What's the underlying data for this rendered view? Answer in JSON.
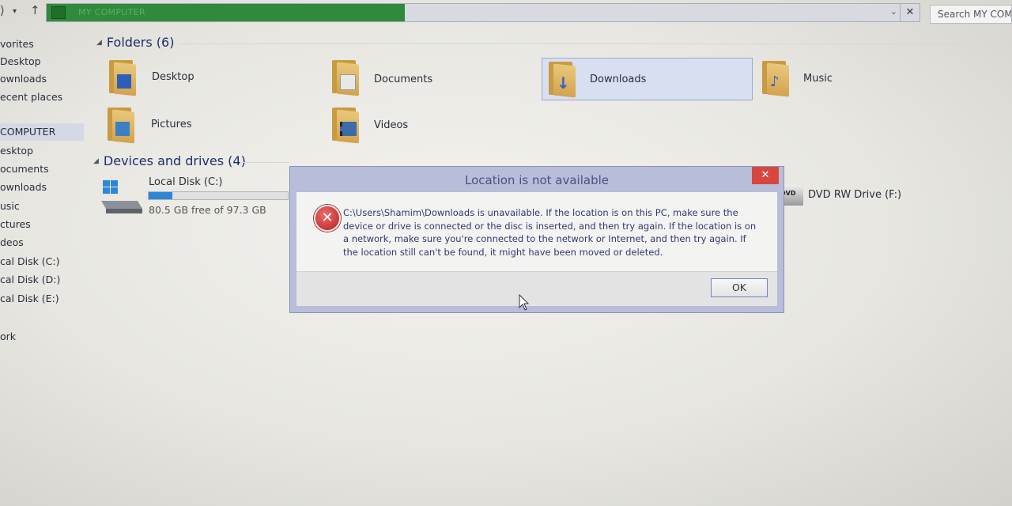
{
  "address_bar": {
    "path": "MY COMPUTER",
    "progress": 0.41
  },
  "search": {
    "placeholder": "Search MY COMP"
  },
  "sidebar": {
    "items": [
      "vorites",
      "Desktop",
      "ownloads",
      "ecent places",
      "COMPUTER",
      "esktop",
      "ocuments",
      "ownloads",
      "usic",
      "ctures",
      "deos",
      "cal Disk (C:)",
      "cal Disk (D:)",
      "cal Disk (E:)",
      "ork"
    ]
  },
  "folders": {
    "title": "Folders (6)",
    "items": [
      "Desktop",
      "Documents",
      "Downloads",
      "Music",
      "Pictures",
      "Videos"
    ]
  },
  "drives": {
    "title": "Devices and drives (4)",
    "local_c": {
      "name": "Local Disk (C:)",
      "free": "80.5 GB free of 97.3 GB",
      "used_fraction": 0.17
    },
    "dvd": {
      "name": "DVD RW Drive (F:)",
      "badge": "DVD"
    }
  },
  "dialog": {
    "title": "Location is not available",
    "close_symbol": "✕",
    "error_symbol": "✕",
    "message": "C:\\Users\\Shamim\\Downloads is unavailable. If the location is on this PC, make sure the device or drive is connected or the disc is inserted, and then try again. If the location is on a network, make sure you're connected to the network or Internet, and then try again. If the location still can't be found, it might have been moved or deleted.",
    "ok_label": "OK"
  },
  "colors": {
    "address_progress": "#2f8a3c",
    "dialog_frame": "#b8bdd9",
    "close_button": "#d8463f",
    "drive_fill": "#2e86d6"
  },
  "icons": {
    "folder": "folder-icon",
    "drive": "hard-drive-icon",
    "dvd": "dvd-drive-icon",
    "error": "error-icon"
  }
}
